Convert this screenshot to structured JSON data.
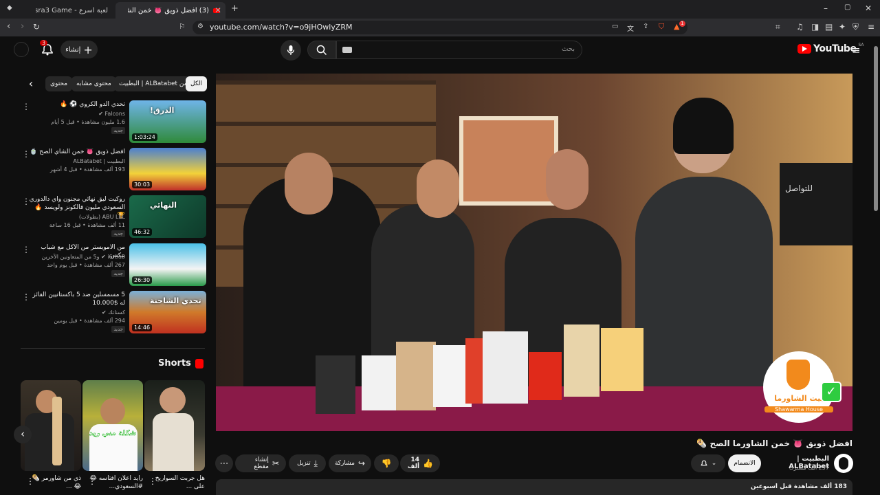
{
  "browser": {
    "tabs": [
      {
        "title": "لعبة اسرع - Asra3 Game | جوله",
        "active": false
      },
      {
        "title": "(3) افضل ذويق 👅 خمن الشاورما",
        "active": true
      }
    ],
    "new_tab": "+",
    "url": "youtube.com/watch?v=o9jHOwlyZRM",
    "brave_badge": "1"
  },
  "header": {
    "logo_text": "YouTube",
    "region": "SA",
    "search_placeholder": "بحث",
    "create_label": "إنشاء",
    "notif_count": "3"
  },
  "chips": [
    {
      "label": "الكل",
      "selected": true
    },
    {
      "label": "من ALBatabet | البطبيت",
      "selected": false
    },
    {
      "label": "محتوى مشابه",
      "selected": false
    },
    {
      "label": "محتوى",
      "selected": false
    }
  ],
  "recommendations": [
    {
      "title": "تحدي الدو الكروي ⚽ 🔥",
      "channel": "Falcons ✔",
      "meta": "1.6 مليون مشاهدة • قبل 5 أيام",
      "badge": "جديد",
      "duration": "1:03:24",
      "thumb_text": "!الدرق"
    },
    {
      "title": "افضل ذويق 👅 خمن الشاي الصح 🍵",
      "channel": "البطبيت | ALBatabet",
      "meta": "193 ألف مشاهدة • قبل 4 أشهر",
      "badge": "",
      "duration": "30:03",
      "thumb_text": ""
    },
    {
      "title": "روكيت ليق نهائي مجنون واي دالدوري السعودي مليون فالكونز ولويسد 🔥 🏆",
      "channel": "ABU LEL (بطولات)",
      "meta": "11 ألف مشاهدة • قبل 16 ساعة",
      "badge": "جديد",
      "duration": "46:32",
      "thumb_text": "النهائي"
    },
    {
      "title": "من الامويستر من الاكل مع شباب بيكس",
      "channel": "i6rba5 ✔ و5 من المتعاونين الآخرين",
      "meta": "267 ألف مشاهدة • قبل يوم واحد",
      "badge": "جديد",
      "duration": "26:30",
      "thumb_text": ""
    },
    {
      "title": "5 مسمسلين ضد 5 باكستانيين الفائز له $10.000",
      "channel": "كسناتك ✔",
      "meta": "294 ألف مشاهدة • قبل يومين",
      "badge": "جديد",
      "duration": "14:46",
      "thumb_text": "تحدي الشاحنة"
    }
  ],
  "shorts": {
    "heading": "Shorts",
    "items": [
      {
        "title": "هل جربت السواريخ على ...",
        "overlay": ""
      },
      {
        "title": "رايد اعلان افتاسه 😂 #السعودي...",
        "overlay": "شكلة مني ريد"
      },
      {
        "title": "ذي من شاورمر 🌯 😂 ..."
      }
    ]
  },
  "video": {
    "title": "افضل ذويق 👅 خمن الشاورما الصح 🌯",
    "channel": "البطبيت | ALBatabet",
    "subscribers": "257 ألف مشترك",
    "join_label": "الانضمام",
    "likes": "14 ألف",
    "share_label": "مشاركة",
    "download_label": "تنزيل",
    "clip_label": "إنشاء مقطع",
    "views_line": "183 ألف مشاهدة قبل اسبوعين",
    "logo_ar": "بيت الشاورما",
    "logo_en": "Shawarma House",
    "sign_text": "للتواصل"
  },
  "colors": {
    "bg": "#0f0f0f",
    "accent": "#ff0000",
    "chip": "#272727",
    "logo_orange": "#f28a1c",
    "check_green": "#2ecc40"
  }
}
